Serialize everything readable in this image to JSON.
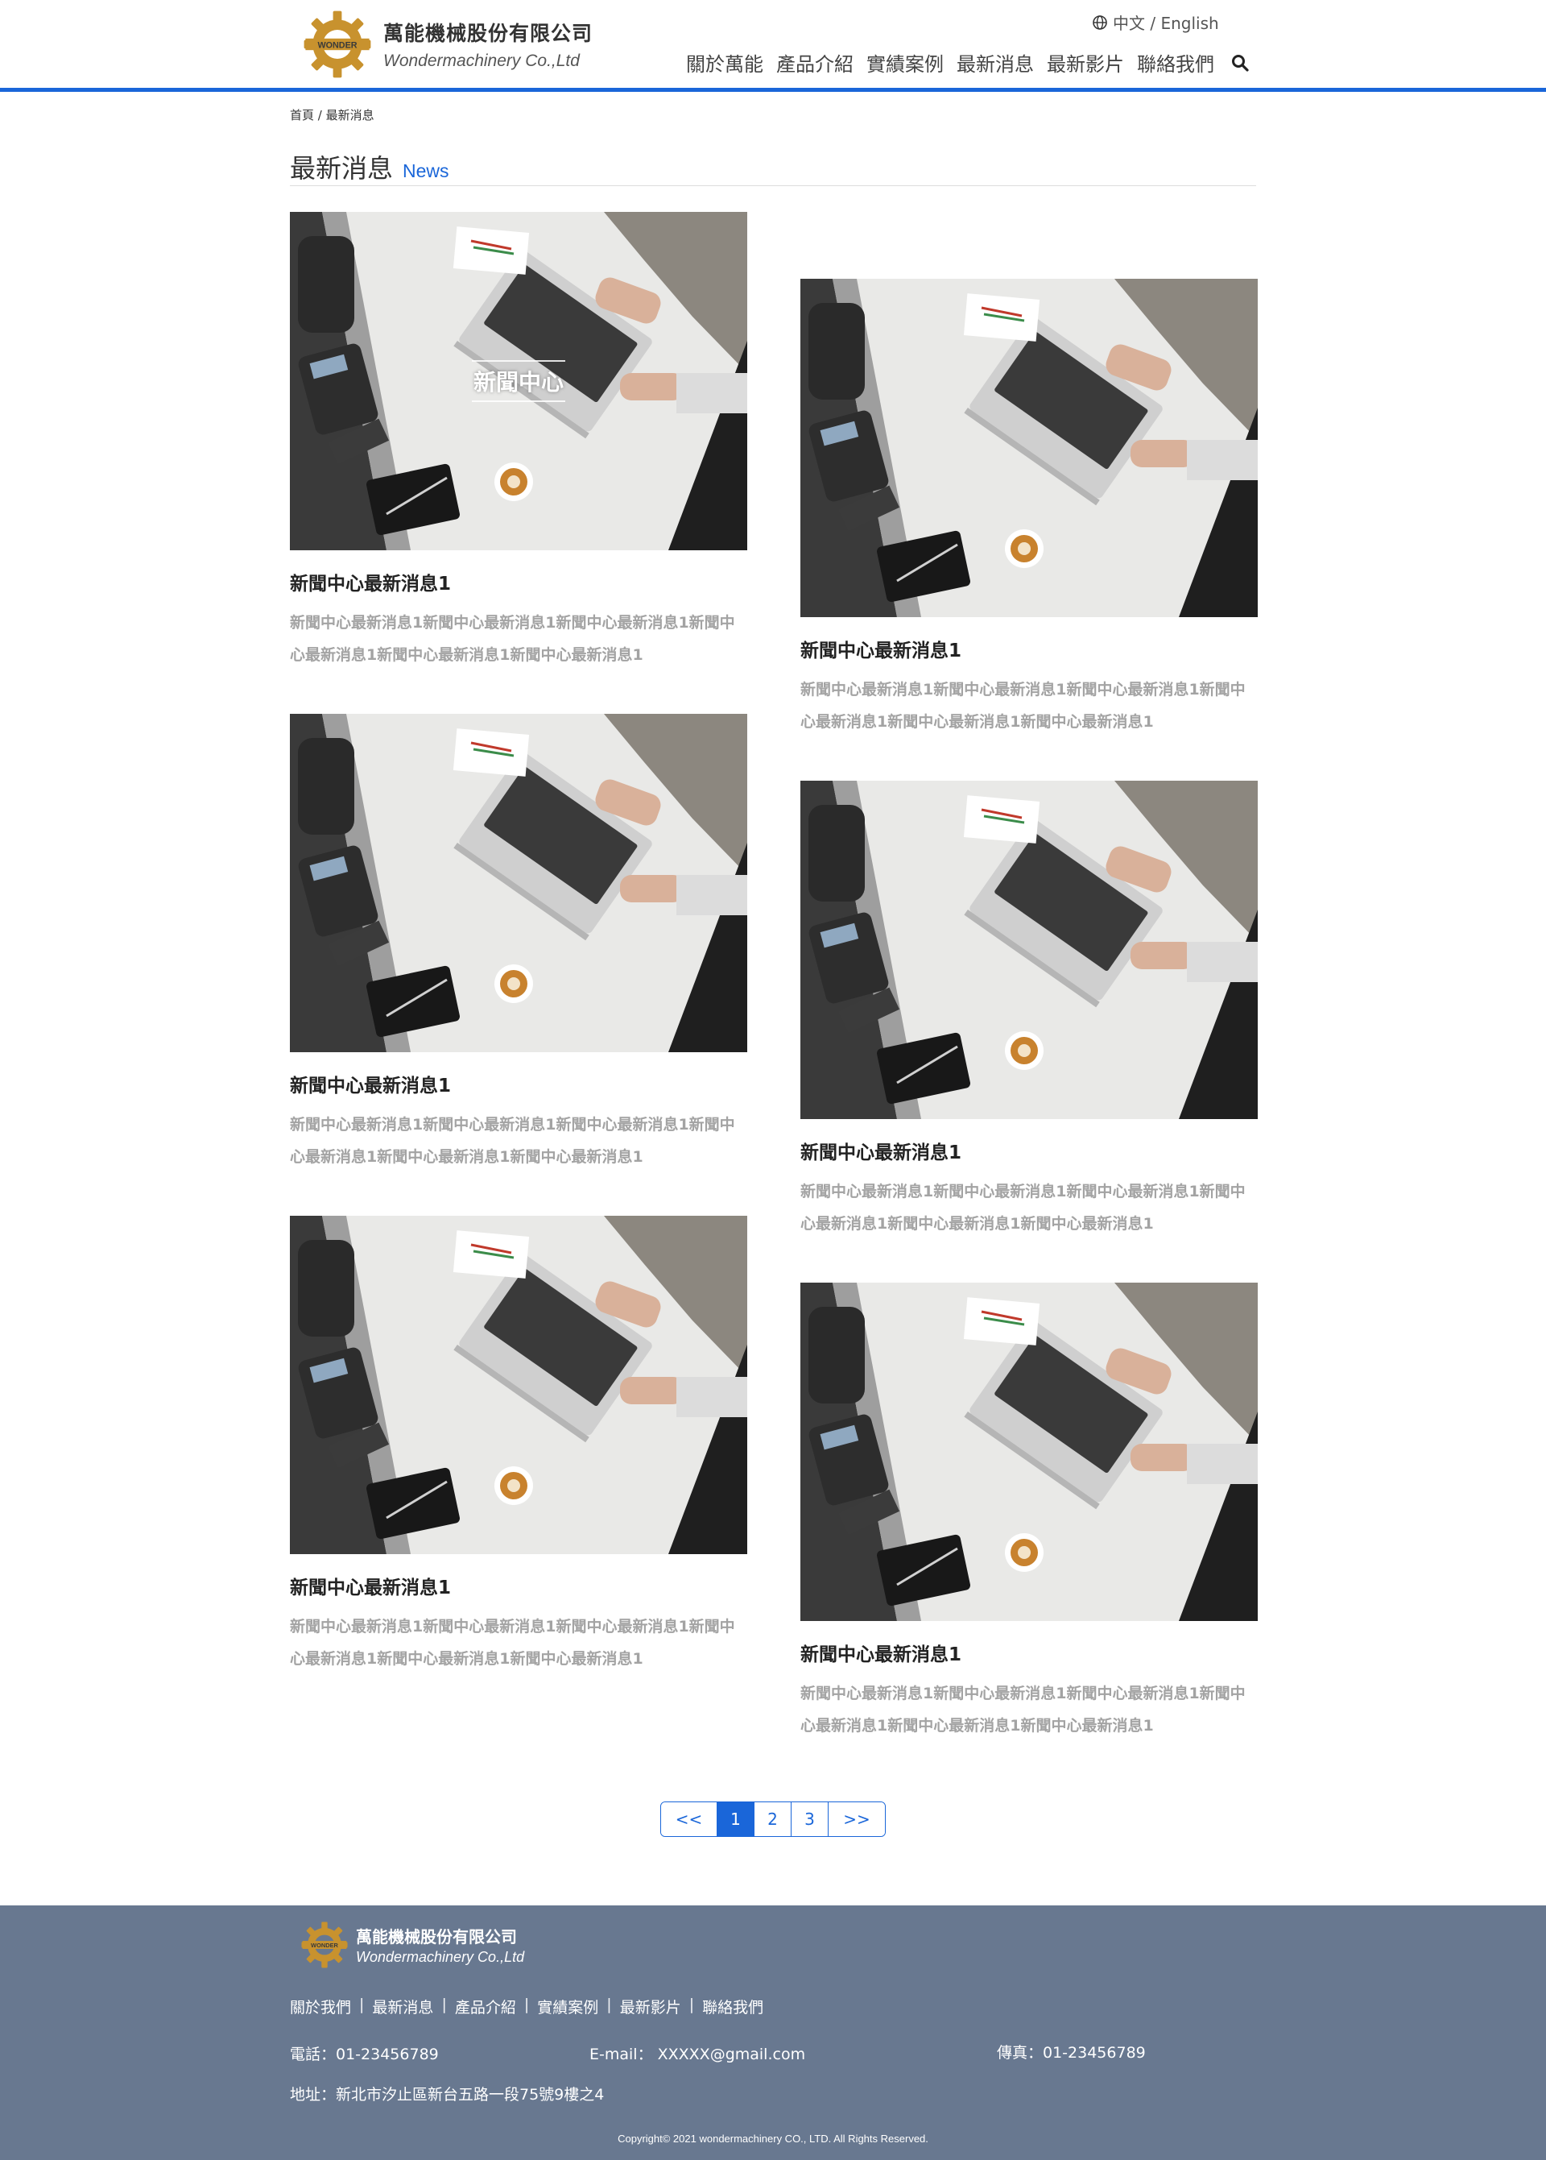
{
  "header": {
    "company_cn": "萬能機械股份有限公司",
    "company_en": "Wondermachinery Co.,Ltd",
    "logo_text": "WONDER",
    "language_switch": "中文 / English",
    "nav": [
      "關於萬能",
      "產品介紹",
      "實績案例",
      "最新消息",
      "最新影片",
      "聯絡我們"
    ]
  },
  "breadcrumb": "首頁 / 最新消息",
  "page_title": {
    "cn": "最新消息",
    "en": "News"
  },
  "news": {
    "overlay_label": "新聞中心",
    "items": [
      {
        "title": "新聞中心最新消息1",
        "desc": "新聞中心最新消息1新聞中心最新消息1新聞中心最新消息1新聞中心最新消息1新聞中心最新消息1新聞中心最新消息1"
      },
      {
        "title": "新聞中心最新消息1",
        "desc": "新聞中心最新消息1新聞中心最新消息1新聞中心最新消息1新聞中心最新消息1新聞中心最新消息1新聞中心最新消息1"
      },
      {
        "title": "新聞中心最新消息1",
        "desc": "新聞中心最新消息1新聞中心最新消息1新聞中心最新消息1新聞中心最新消息1新聞中心最新消息1新聞中心最新消息1"
      },
      {
        "title": "新聞中心最新消息1",
        "desc": "新聞中心最新消息1新聞中心最新消息1新聞中心最新消息1新聞中心最新消息1新聞中心最新消息1新聞中心最新消息1"
      },
      {
        "title": "新聞中心最新消息1",
        "desc": "新聞中心最新消息1新聞中心最新消息1新聞中心最新消息1新聞中心最新消息1新聞中心最新消息1新聞中心最新消息1"
      },
      {
        "title": "新聞中心最新消息1",
        "desc": "新聞中心最新消息1新聞中心最新消息1新聞中心最新消息1新聞中心最新消息1新聞中心最新消息1新聞中心最新消息1"
      }
    ]
  },
  "pagination": {
    "prev": "<<",
    "pages": [
      "1",
      "2",
      "3"
    ],
    "current": "1",
    "next": ">>"
  },
  "footer": {
    "company_cn": "萬能機械股份有限公司",
    "company_en": "Wondermachinery Co.,Ltd",
    "links": [
      "關於我們",
      "最新消息",
      "產品介紹",
      "實績案例",
      "最新影片",
      "聯絡我們"
    ],
    "phone": "電話：01-23456789",
    "email": "E-mail：  XXXXX@gmail.com",
    "fax": "傳真：01-23456789",
    "address": "地址：新北市汐止區新台五路一段75號9樓之4",
    "copyright": "Copyright© 2021 wondermachinery  CO., LTD. All Rights Reserved."
  },
  "colors": {
    "accent": "#1a66d9",
    "footer_bg": "#687890",
    "logo_gold": "#c8922e"
  },
  "icons": [
    "globe-icon",
    "search-icon",
    "gear-logo-icon"
  ]
}
